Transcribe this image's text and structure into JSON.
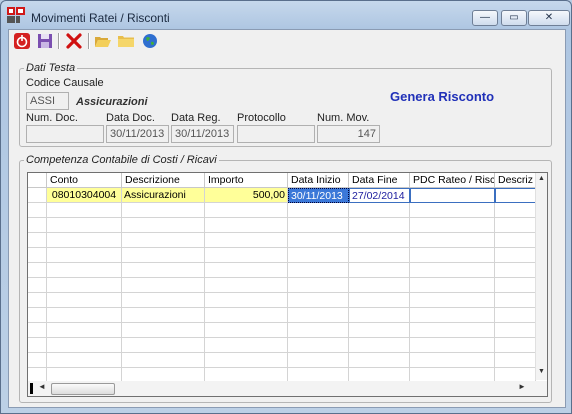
{
  "window": {
    "title": "Movimenti Ratei / Risconti",
    "minimize_glyph": "—",
    "maximize_glyph": "▭",
    "close_glyph": "✕"
  },
  "toolbar": {
    "icons": [
      "power-icon",
      "save-icon",
      "delete-icon",
      "open-folder-icon",
      "folder-icon",
      "globe-icon"
    ]
  },
  "dati_testa": {
    "legend": "Dati Testa",
    "codice_causale_label": "Codice Causale",
    "codice_causale_value": "ASSI",
    "causale_descrizione": "Assicurazioni",
    "num_doc_label": "Num. Doc.",
    "num_doc_value": "",
    "data_doc_label": "Data Doc.",
    "data_doc_value": "30/11/2013",
    "data_reg_label": "Data Reg.",
    "data_reg_value": "30/11/2013",
    "protocollo_label": "Protocollo",
    "protocollo_value": "",
    "num_mov_label": "Num. Mov.",
    "num_mov_value": "147",
    "genera_label": "Genera Risconto"
  },
  "competenza": {
    "legend": "Competenza Contabile di Costi / Ricavi",
    "columns": [
      "Conto",
      "Descrizione",
      "Importo",
      "Data Inizio",
      "Data Fine",
      "PDC Rateo / Risc.",
      "Descriz"
    ],
    "rows": [
      {
        "conto": "08010304004",
        "descrizione": "Assicurazioni",
        "importo": "500,00",
        "data_inizio": "30/11/2013",
        "data_fine": "27/02/2014",
        "pdc": "",
        "descriz": ""
      }
    ]
  },
  "colors": {
    "accent": "#2030b8",
    "selected_row": "#ffff99",
    "selected_cell": "#3b78d8"
  }
}
